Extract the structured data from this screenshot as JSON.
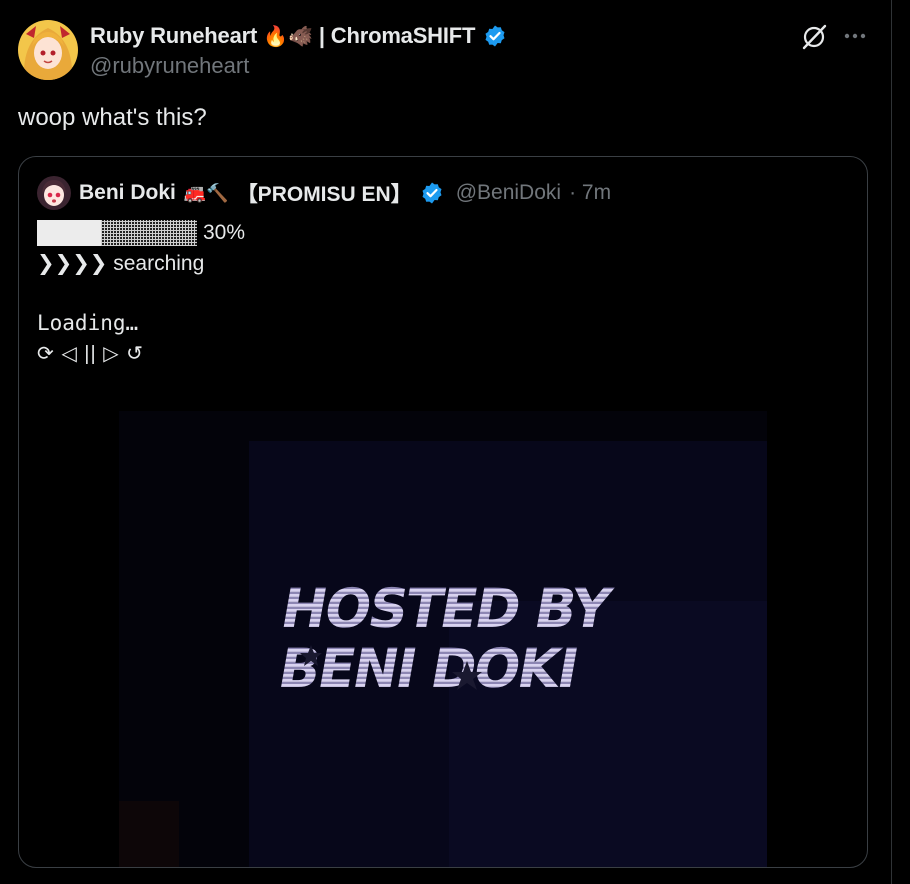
{
  "tweet": {
    "author": {
      "display_name": "Ruby Runeheart",
      "name_emojis": "🔥🐗",
      "name_suffix": "| ChromaSHIFT",
      "handle": "@rubyruneheart",
      "verified": true
    },
    "text": "woop what's this?",
    "icons": [
      "grok-icon",
      "more-options-icon"
    ]
  },
  "quote": {
    "author": {
      "display_name": "Beni Doki",
      "name_emojis": "🚒🔨",
      "name_suffix": "【PROMISU EN】",
      "handle": "@BeniDoki",
      "time": "· 7m",
      "verified": true
    },
    "progress": {
      "value": 0.3,
      "label": "30%"
    },
    "line_searching": "❯❯❯❯ searching",
    "line_loading": "Loading…",
    "line_controls": "⟳ ◁ || ▷ ↺",
    "media_text": {
      "line1": "HOSTED BY",
      "line2": "BENI DOKI"
    }
  },
  "colors": {
    "background": "#000000",
    "text": "#e7e9ea",
    "secondary_text": "#71767b",
    "verified_blue": "#1d9bf0",
    "border": "#3a3f44"
  }
}
